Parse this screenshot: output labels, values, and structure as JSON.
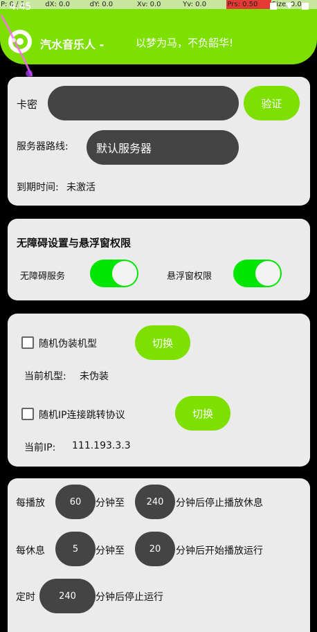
{
  "debug": {
    "p": "P: 0 / 1",
    "dx": "dX: 0.0",
    "dy": "dY: 0.0",
    "xv": "Xv: 0.0",
    "yv": "Yv: 0.0",
    "prs": "Prs: 0.50",
    "size": "Size: 0.0"
  },
  "status": {
    "time": "4:45"
  },
  "header": {
    "title": "汽水音乐人 -",
    "slogan": "以梦为马，不负韶华!"
  },
  "activation": {
    "card_key_label": "卡密",
    "card_key_value": "",
    "verify_label": "验证",
    "server_label": "服务器路线:",
    "server_value": "默认服务器",
    "expiry_label": "到期时间:",
    "expiry_value": "未激活"
  },
  "permissions": {
    "title": "无障碍设置与悬浮窗权限",
    "accessibility_label": "无障碍服务",
    "accessibility_on": true,
    "overlay_label": "悬浮窗权限",
    "overlay_on": true
  },
  "disguise": {
    "random_model_label": "随机伪装机型",
    "random_model_checked": false,
    "switch_model_label": "切换",
    "current_model_label": "当前机型:",
    "current_model_value": "未伪装",
    "random_ip_label": "随机IP连接跳转协议",
    "random_ip_checked": false,
    "switch_ip_label": "切换",
    "current_ip_label": "当前IP:",
    "current_ip_value": "111.193.3.3"
  },
  "schedule": {
    "play_prefix": "每播放",
    "play_min": "60",
    "to1": "分钟至",
    "play_max": "240",
    "play_suffix": "分钟后停止播放休息",
    "rest_prefix": "每休息",
    "rest_min": "5",
    "to2": "分钟至",
    "rest_max": "20",
    "rest_suffix": "分钟后开始播放运行",
    "timer_prefix": "定时",
    "timer_value": "240",
    "timer_suffix": "分钟后停止运行"
  },
  "colors": {
    "accent": "#7ee000",
    "toggle_on": "#00e600",
    "pill_dark": "#444444",
    "card_bg": "#ebebeb"
  }
}
